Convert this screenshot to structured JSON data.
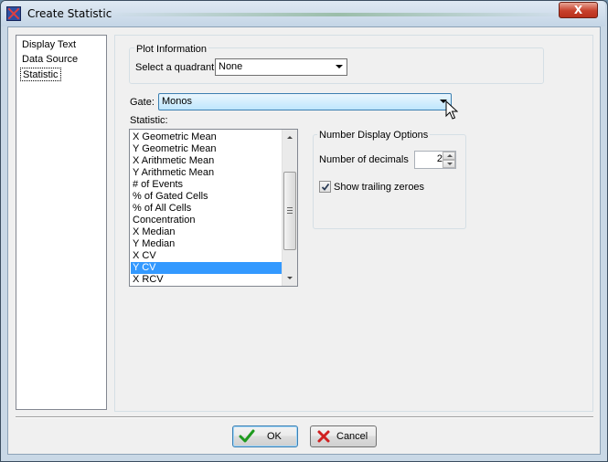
{
  "window": {
    "title": "Create Statistic",
    "close_label": "X"
  },
  "nav": {
    "items": [
      {
        "label": "Display Text",
        "selected": false
      },
      {
        "label": "Data Source",
        "selected": false
      },
      {
        "label": "Statistic",
        "selected": true
      }
    ]
  },
  "plot_info": {
    "group_label": "Plot Information",
    "quadrant_label": "Select a quadrant",
    "quadrant_value": "None"
  },
  "gate": {
    "label": "Gate:",
    "value": "Monos"
  },
  "statistic": {
    "label": "Statistic:",
    "items": [
      {
        "label": "X Geometric Mean",
        "selected": false
      },
      {
        "label": "Y Geometric Mean",
        "selected": false
      },
      {
        "label": "X Arithmetic Mean",
        "selected": false
      },
      {
        "label": "Y Arithmetic Mean",
        "selected": false
      },
      {
        "label": "# of Events",
        "selected": false
      },
      {
        "label": "% of Gated Cells",
        "selected": false
      },
      {
        "label": "% of All Cells",
        "selected": false
      },
      {
        "label": "Concentration",
        "selected": false
      },
      {
        "label": "X Median",
        "selected": false
      },
      {
        "label": "Y Median",
        "selected": false
      },
      {
        "label": "X CV",
        "selected": false
      },
      {
        "label": "Y CV",
        "selected": true
      },
      {
        "label": "X RCV",
        "selected": false
      }
    ]
  },
  "number_display": {
    "group_label": "Number Display Options",
    "decimals_label": "Number of decimals",
    "decimals_value": "2",
    "trailing_label": "Show trailing zeroes",
    "trailing_checked": true
  },
  "buttons": {
    "ok_label": "OK",
    "cancel_label": "Cancel"
  },
  "colors": {
    "selection": "#3399ff",
    "ok_check": "#1e9a1e",
    "cancel_x": "#d02020"
  },
  "icons": {
    "app": "app-logo-icon",
    "ok": "checkmark-icon",
    "cancel": "x-icon",
    "cursor": "mouse-pointer-icon"
  }
}
